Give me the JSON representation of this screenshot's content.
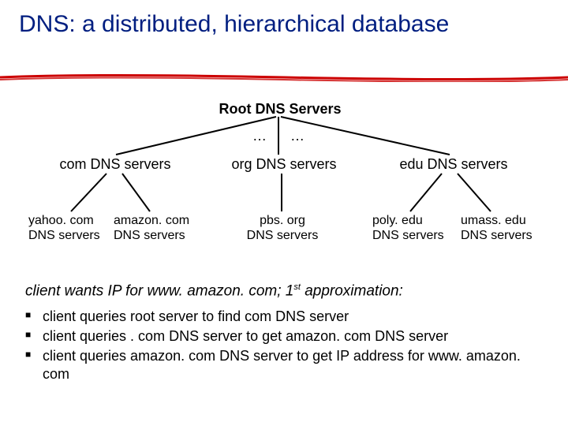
{
  "title": "DNS: a distributed, hierarchical database",
  "diagram": {
    "root": "Root DNS Servers",
    "ellipsis1": "…",
    "ellipsis2": "…",
    "level2": {
      "com": "com DNS servers",
      "org": "org DNS servers",
      "edu": "edu DNS servers"
    },
    "level3": {
      "yahoo": {
        "l1": "yahoo. com",
        "l2": "DNS servers"
      },
      "amazon": {
        "l1": "amazon. com",
        "l2": "DNS servers"
      },
      "pbs": {
        "l1": "pbs. org",
        "l2": "DNS servers"
      },
      "poly": {
        "l1": "poly. edu",
        "l2": "DNS servers"
      },
      "umass": {
        "l1": "umass. edu",
        "l2": "DNS servers"
      }
    }
  },
  "scenario_prefix": "client wants IP for www. amazon. com; 1",
  "scenario_sup": "st",
  "scenario_suffix": " approximation:",
  "bullets": {
    "b1": "client queries root server to find com DNS server",
    "b2": "client queries . com DNS server to get amazon. com DNS server",
    "b3": "client queries amazon. com DNS server to get  IP address for www. amazon. com"
  }
}
